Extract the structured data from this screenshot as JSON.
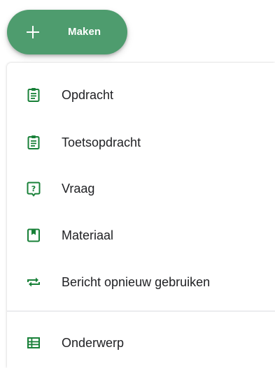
{
  "create_button": {
    "label": "Maken",
    "icon": "plus-icon",
    "background_color": "#4e9c6e"
  },
  "menu": {
    "items": [
      {
        "label": "Opdracht",
        "icon": "assignment-icon"
      },
      {
        "label": "Toetsopdracht",
        "icon": "quiz-assignment-icon"
      },
      {
        "label": "Vraag",
        "icon": "question-icon"
      },
      {
        "label": "Materiaal",
        "icon": "material-icon"
      },
      {
        "label": "Bericht opnieuw gebruiken",
        "icon": "reuse-icon"
      }
    ],
    "secondary_items": [
      {
        "label": "Onderwerp",
        "icon": "topic-icon"
      }
    ],
    "icon_color": "#188038"
  }
}
